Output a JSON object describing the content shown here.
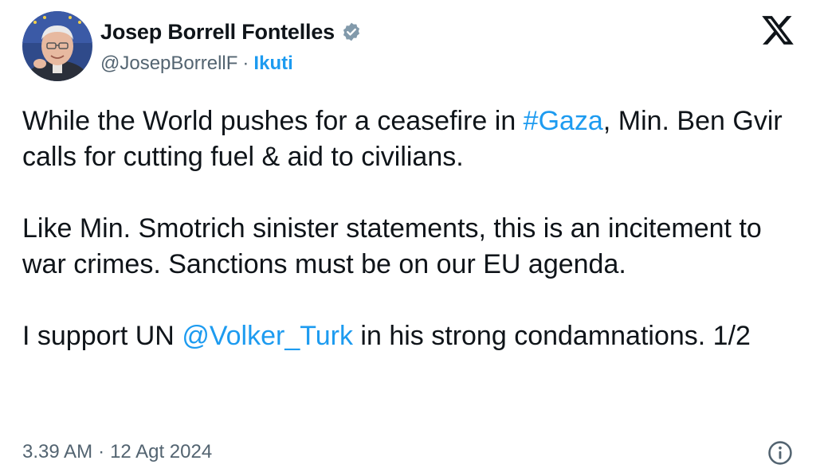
{
  "author": {
    "display_name": "Josep Borrell Fontelles",
    "handle": "@JosepBorrellF",
    "separator": "·",
    "follow_label": "Ikuti",
    "avatar_icon": "profile-photo",
    "verified_icon": "verified-badge-icon",
    "verified_color": "#829aab"
  },
  "brand": {
    "logo_icon": "x-logo-icon",
    "color": "#0f1419"
  },
  "tweet": {
    "paragraph1": {
      "before": "While the World pushes for a ceasefire in ",
      "hashtag": "#Gaza",
      "after": ", Min. Ben Gvir calls for cutting fuel & aid to civilians."
    },
    "paragraph2": "Like Min. Smotrich sinister statements, this is an incitement to war crimes. Sanctions must be on our EU agenda.",
    "paragraph3": {
      "before": "I support UN ",
      "mention": "@Volker_Turk",
      "after": " in his strong condamnations. 1/2"
    }
  },
  "meta": {
    "time": "3.39 AM",
    "separator": "·",
    "date": "12 Agt 2024",
    "info_icon": "info-icon"
  },
  "colors": {
    "text": "#0f1419",
    "secondary": "#536471",
    "link": "#1d9bf0"
  }
}
